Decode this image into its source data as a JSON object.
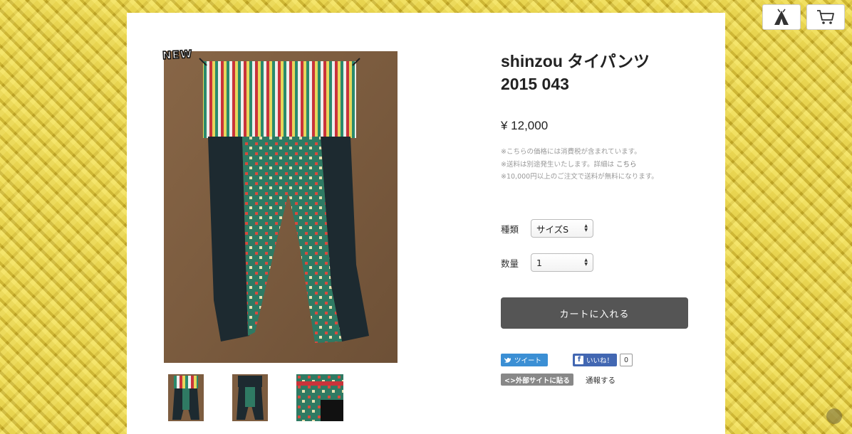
{
  "header": {
    "icons": [
      "tent-icon",
      "cart-icon"
    ]
  },
  "product": {
    "badge": "NEW",
    "title_line1": "shinzou タイパンツ",
    "title_line2": "2015 043",
    "price": "¥ 12,000",
    "notes": {
      "tax": "※こちらの価格には消費税が含まれています。",
      "shipping_prefix": "※送料は別途発生いたします。詳細は",
      "shipping_link": "こちら",
      "free_shipping": "※10,000円以上のご注文で送料が無料になります。"
    },
    "options": {
      "type_label": "種類",
      "type_value": "サイズS",
      "qty_label": "数量",
      "qty_value": "1"
    },
    "cart_button": "カートに入れる"
  },
  "social": {
    "tweet": "ツイート",
    "like": "いいね！",
    "like_count": "0",
    "embed": "<>外部サイトに貼る",
    "report": "通報する"
  },
  "colors": {
    "background": "#d9c43e",
    "cart_button": "#555555",
    "twitter": "#3b8fd4",
    "facebook": "#4267b2"
  }
}
